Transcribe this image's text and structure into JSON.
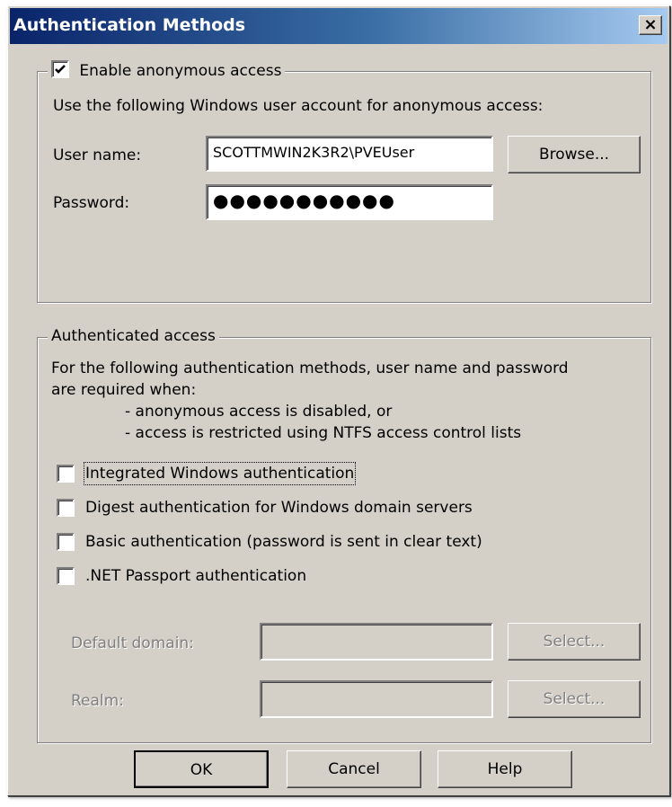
{
  "window": {
    "title": "Authentication Methods",
    "close_glyph": "×"
  },
  "anonymous": {
    "enable_label": "Enable anonymous access",
    "enable_checked": true,
    "description": "Use the following Windows user account for anonymous access:",
    "username_label": "User name:",
    "username_value": "SCOTTMWIN2K3R2\\PVEUser",
    "browse_label": "Browse...",
    "password_label": "Password:",
    "password_value": "●●●●●●●●●●●"
  },
  "authenticated": {
    "legend": "Authenticated access",
    "description_line1": "For the following authentication methods, user name and password",
    "description_line2": "are required when:",
    "bullet1": "- anonymous access is disabled, or",
    "bullet2": "- access is restricted using NTFS access control lists",
    "options": [
      {
        "label": "Integrated Windows authentication",
        "checked": false
      },
      {
        "label": "Digest authentication for Windows domain servers",
        "checked": false
      },
      {
        "label": "Basic authentication (password is sent in clear text)",
        "checked": false
      },
      {
        "label": ".NET Passport authentication",
        "checked": false
      }
    ],
    "default_domain_label": "Default domain:",
    "default_domain_value": "",
    "realm_label": "Realm:",
    "realm_value": "",
    "select_label": "Select..."
  },
  "buttons": {
    "ok": "OK",
    "cancel": "Cancel",
    "help": "Help"
  }
}
